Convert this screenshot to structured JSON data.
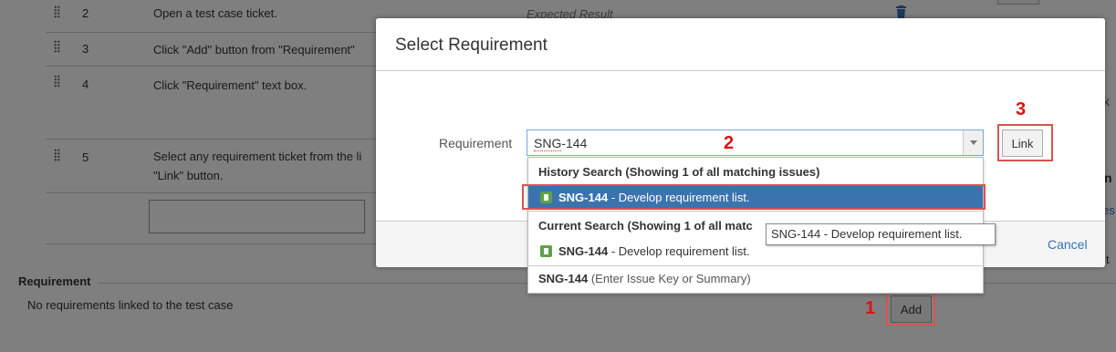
{
  "steps": [
    {
      "num": "2",
      "text": "Open a test case ticket."
    },
    {
      "num": "3",
      "text": "Click \"Add\" button from \"Requirement\""
    },
    {
      "num": "4",
      "text": "Click \"Requirement\" text box."
    },
    {
      "num": "5",
      "text_line1": "Select any requirement ticket from the li",
      "text_line2": "\"Link\" button."
    }
  ],
  "expected_result_placeholder": "Expected Result",
  "requirement_section": {
    "title": "Requirement",
    "empty_text": "No requirements linked to the test case",
    "add_label": "Add"
  },
  "dialog": {
    "title": "Select Requirement",
    "field_label": "Requirement",
    "input_value_prefix": "SNG",
    "input_value_suffix": "-144",
    "link_label": "Link",
    "cancel_label": "Cancel"
  },
  "dropdown": {
    "history_header": "History Search (Showing 1 of all matching issues)",
    "current_header_visible": "Current Search (Showing 1 of all matc",
    "history_item": {
      "key": "SNG-144",
      "summary": " - Develop requirement list."
    },
    "current_item": {
      "key": "SNG-144",
      "summary": " - Develop requirement list."
    },
    "free_text": {
      "key": "SNG-144",
      "hint": " (Enter Issue Key or Summary)"
    }
  },
  "tooltip": "SNG-144 - Develop requirement list.",
  "annotations": {
    "one": "1",
    "two": "2",
    "three": "3"
  },
  "icons": {
    "trash": "trash-icon",
    "drag": "drag-handle-icon",
    "dropdown_arrow": "chevron-down-icon",
    "issue_type": "requirement-issue-icon"
  },
  "colors": {
    "selected_bg": "#3b73af",
    "link_blue": "#3572b0",
    "annotation_red": "#dd1111",
    "issue_icon_green": "#5ea04a"
  }
}
